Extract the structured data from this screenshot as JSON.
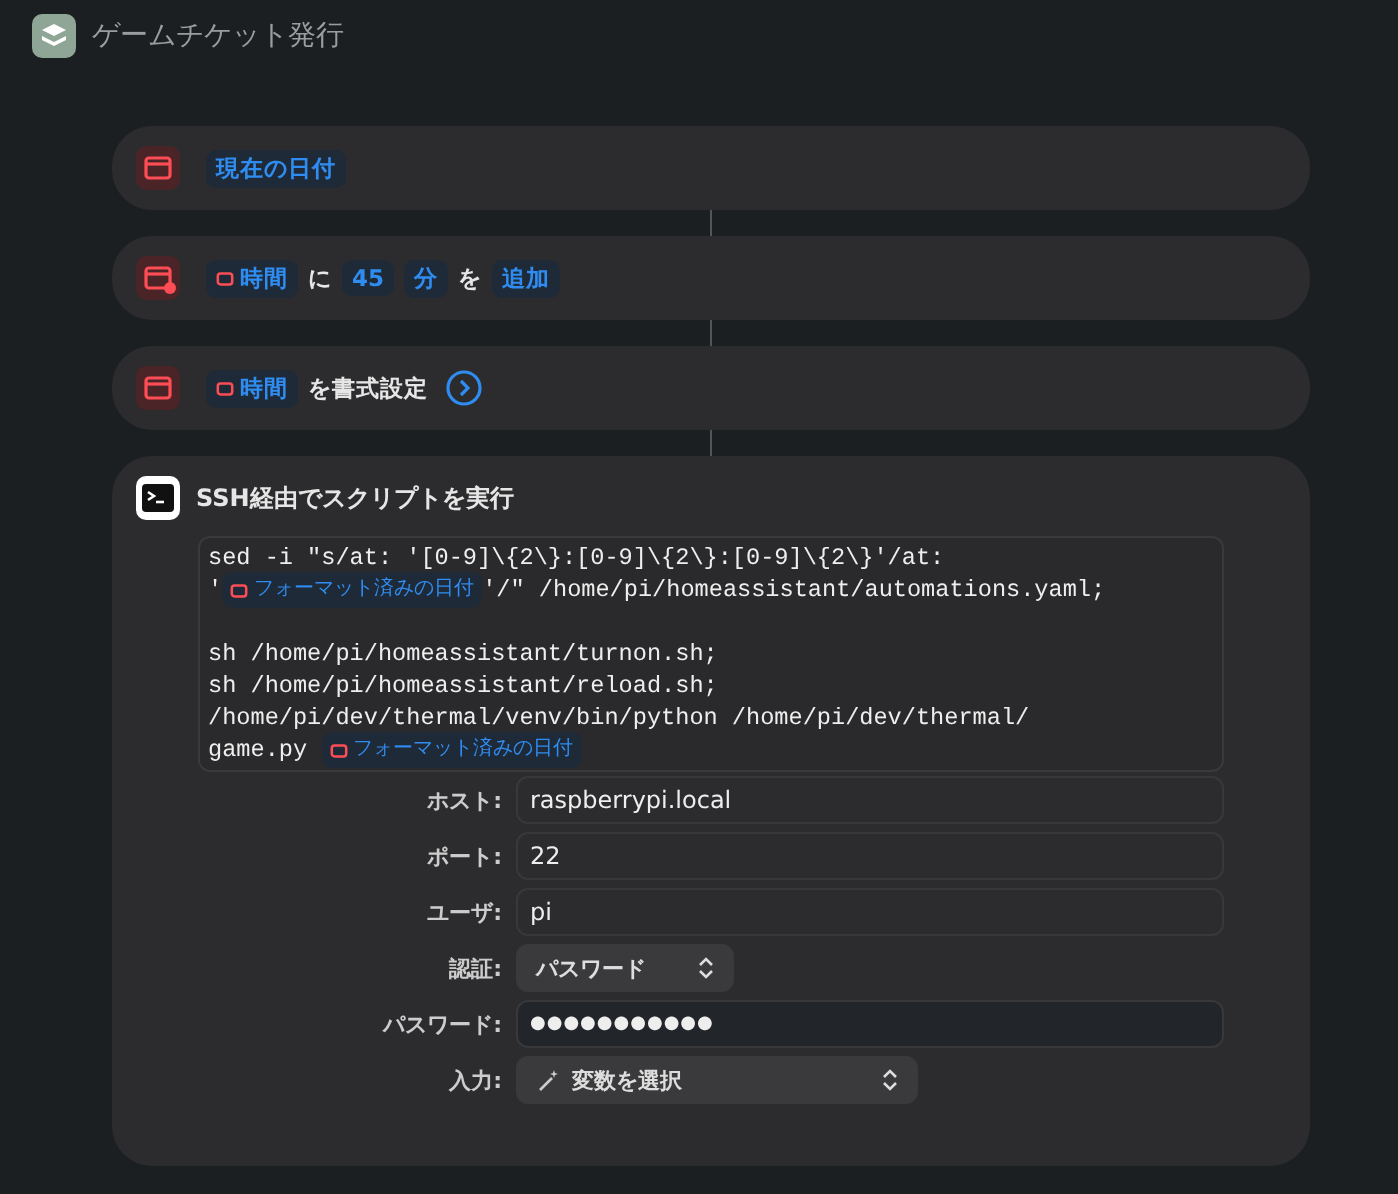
{
  "window": {
    "title": "ゲームチケット発行"
  },
  "actions": [
    {
      "kind": "date",
      "parts": [
        {
          "kind": "token",
          "text": "現在の日付"
        }
      ]
    },
    {
      "kind": "adjust",
      "parts": [
        {
          "kind": "var",
          "text": "時間"
        },
        {
          "kind": "text",
          "text": "に"
        },
        {
          "kind": "token",
          "text": "45"
        },
        {
          "kind": "token",
          "text": "分"
        },
        {
          "kind": "text",
          "text": "を"
        },
        {
          "kind": "token",
          "text": "追加"
        }
      ]
    },
    {
      "kind": "format",
      "parts": [
        {
          "kind": "var",
          "text": "時間"
        },
        {
          "kind": "text",
          "text": "を書式設定"
        },
        {
          "kind": "more"
        }
      ]
    },
    {
      "kind": "ssh",
      "title": "SSH経由でスクリプトを実行",
      "script": [
        [
          [
            {
              "kind": "text",
              "text": "sed -i \"s/at: '[0-9]\\{2\\}:[0-9]\\{2\\}:[0-9]\\{2\\}'/at:"
            }
          ],
          [
            {
              "kind": "text",
              "text": "'"
            },
            {
              "kind": "var",
              "text": "フォーマット済みの日付"
            },
            {
              "kind": "text",
              "text": "'/\" /home/pi/homeassistant/automations.yaml;"
            }
          ]
        ],
        [
          [
            {
              "kind": "text",
              "text": "sh /home/pi/homeassistant/turnon.sh;"
            }
          ],
          [
            {
              "kind": "text",
              "text": "sh /home/pi/homeassistant/reload.sh;"
            }
          ],
          [
            {
              "kind": "text",
              "text": "/home/pi/dev/thermal/venv/bin/python /home/pi/dev/thermal/"
            }
          ],
          [
            {
              "kind": "text",
              "text": "game.py "
            },
            {
              "kind": "var",
              "text": "フォーマット済みの日付"
            }
          ]
        ]
      ],
      "fields": [
        {
          "kind": "text",
          "label": "ホスト:",
          "value": "raspberrypi.local"
        },
        {
          "kind": "text",
          "label": "ポート:",
          "value": "22"
        },
        {
          "kind": "text",
          "label": "ユーザ:",
          "value": "pi"
        },
        {
          "kind": "popup",
          "label": "認証:",
          "value": "パスワード"
        },
        {
          "kind": "password",
          "label": "パスワード:",
          "value": "●●●●●●●●●●●"
        },
        {
          "kind": "variable",
          "label": "入力:",
          "value": "変数を選択"
        }
      ]
    }
  ]
}
